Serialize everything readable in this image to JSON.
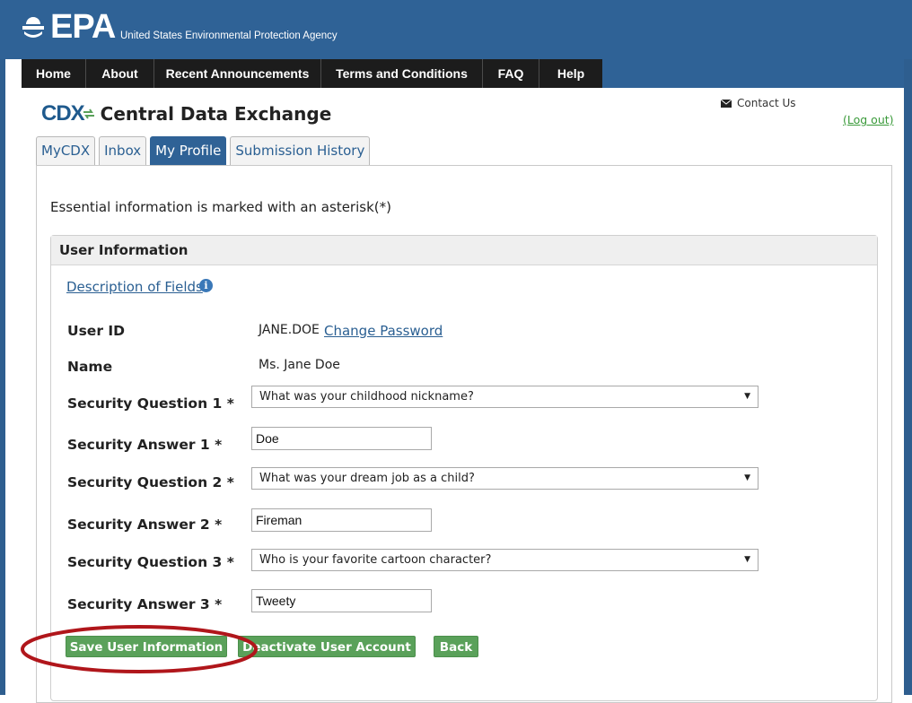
{
  "brand": {
    "logo_text": "EPA",
    "agency_name": "United States Environmental Protection Agency",
    "banner_color": "#2f6296"
  },
  "nav": {
    "items": [
      {
        "label": "Home"
      },
      {
        "label": "About"
      },
      {
        "label": "Recent Announcements"
      },
      {
        "label": "Terms and Conditions"
      },
      {
        "label": "FAQ"
      },
      {
        "label": "Help"
      }
    ]
  },
  "header": {
    "cdx_mark": "CDX",
    "title": "Central Data Exchange",
    "contact_label": "Contact Us",
    "logout_label": "(Log out)"
  },
  "tabs": [
    {
      "label": "MyCDX",
      "active": false
    },
    {
      "label": "Inbox",
      "active": false
    },
    {
      "label": "My Profile",
      "active": true
    },
    {
      "label": "Submission History",
      "active": false
    }
  ],
  "form": {
    "essential_note": "Essential information is marked with an asterisk(*)",
    "panel_title": "User Information",
    "description_link": "Description of Fields",
    "user_id_label": "User ID",
    "user_id_value": "JANE.DOE",
    "change_password": "Change Password",
    "name_label": "Name",
    "name_value": "Ms. Jane Doe",
    "fields": [
      {
        "q_label": "Security Question 1 *",
        "q_value": "What was your childhood nickname?",
        "a_label": "Security Answer 1 *",
        "a_value": "Doe"
      },
      {
        "q_label": "Security Question 2 *",
        "q_value": "What was your dream job as a child?",
        "a_label": "Security Answer 2 *",
        "a_value": "Fireman"
      },
      {
        "q_label": "Security Question 3 *",
        "q_value": "Who is your favorite cartoon character?",
        "a_label": "Security Answer 3 *",
        "a_value": "Tweety"
      }
    ]
  },
  "buttons": {
    "save": "Save User Information",
    "deactivate": "Deactivate User Account",
    "back": "Back",
    "button_color": "#5aa15a"
  },
  "annotation": {
    "highlight_color": "#b0161b"
  }
}
